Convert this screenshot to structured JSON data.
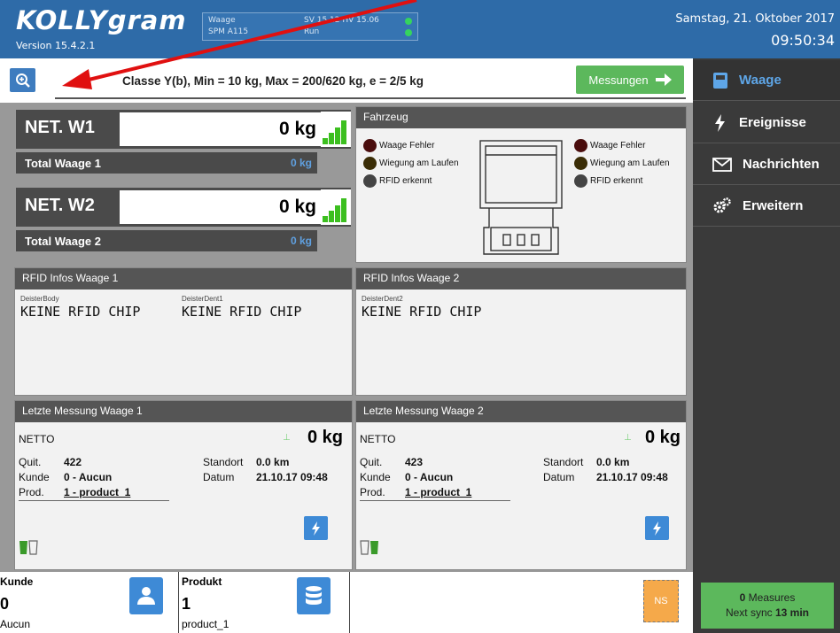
{
  "header": {
    "logo": "KOLLYgram",
    "version": "Version 15.4.2.1",
    "status": {
      "device_line1": "Waage",
      "device_line2": "SPM A115",
      "sv_label": "SV 15.12 HV 15.06",
      "run": "Run"
    },
    "date": "Samstag, 21. Oktober 2017",
    "time": "09:50:34"
  },
  "topbar": {
    "classe": "Classe Y(b), Min = 10 kg, Max = 200/620 kg, e = 2/5 kg",
    "measure_button": "Messungen"
  },
  "sidebar": {
    "items": [
      {
        "label": "Waage",
        "icon": "scale-icon"
      },
      {
        "label": "Ereignisse",
        "icon": "lightning-icon"
      },
      {
        "label": "Nachrichten",
        "icon": "envelope-icon"
      },
      {
        "label": "Erweitern",
        "icon": "gears-icon"
      }
    ]
  },
  "scales": {
    "w1": {
      "label": "NET. W1",
      "value": "0 kg",
      "total_label": "Total Waage 1",
      "total_value": "0 kg"
    },
    "w2": {
      "label": "NET. W2",
      "value": "0 kg",
      "total_label": "Total Waage 2",
      "total_value": "0 kg"
    }
  },
  "fahrzeug": {
    "title": "Fahrzeug",
    "left": [
      "Waage Fehler",
      "Wiegung am Laufen",
      "RFID erkennt"
    ],
    "right": [
      "Waage Fehler",
      "Wiegung am Laufen",
      "RFID erkennt"
    ]
  },
  "rfid1": {
    "title": "RFID Infos Waage 1",
    "field1_label": "DeisterBody",
    "field1_value": "KEINE RFID CHIP",
    "field2_label": "DeisterDent1",
    "field2_value": "KEINE RFID CHIP"
  },
  "rfid2": {
    "title": "RFID Infos Waage 2",
    "field1_label": "DeisterDent2",
    "field1_value": "KEINE RFID CHIP"
  },
  "last1": {
    "title": "Letzte Messung Waage 1",
    "netto": "NETTO",
    "value": "0 kg",
    "quit_label": "Quit.",
    "quit": "422",
    "standort_label": "Standort",
    "standort": "0.0 km",
    "kunde_label": "Kunde",
    "kunde": "0 - Aucun",
    "datum_label": "Datum",
    "datum": "21.10.17 09:48",
    "prod_label": "Prod.",
    "prod": "1 - product_1"
  },
  "last2": {
    "title": "Letzte Messung Waage 2",
    "netto": "NETTO",
    "value": "0 kg",
    "quit_label": "Quit.",
    "quit": "423",
    "standort_label": "Standort",
    "standort": "0.0 km",
    "kunde_label": "Kunde",
    "kunde": "0 - Aucun",
    "datum_label": "Datum",
    "datum": "21.10.17 09:48",
    "prod_label": "Prod.",
    "prod": "1 - product_1"
  },
  "bottom": {
    "kunde_label": "Kunde",
    "kunde_num": "0",
    "kunde_name": "Aucun",
    "produkt_label": "Produkt",
    "produkt_num": "1",
    "produkt_name": "product_1",
    "ns": "NS",
    "sync_count": "0",
    "sync_measures": "Measures",
    "sync_next": "Next sync",
    "sync_time": "13 min"
  },
  "colors": {
    "header": "#2e6ba8",
    "accent_green": "#5cb85c",
    "sidebar": "#3a3a3a",
    "arrow": "#e01010"
  }
}
